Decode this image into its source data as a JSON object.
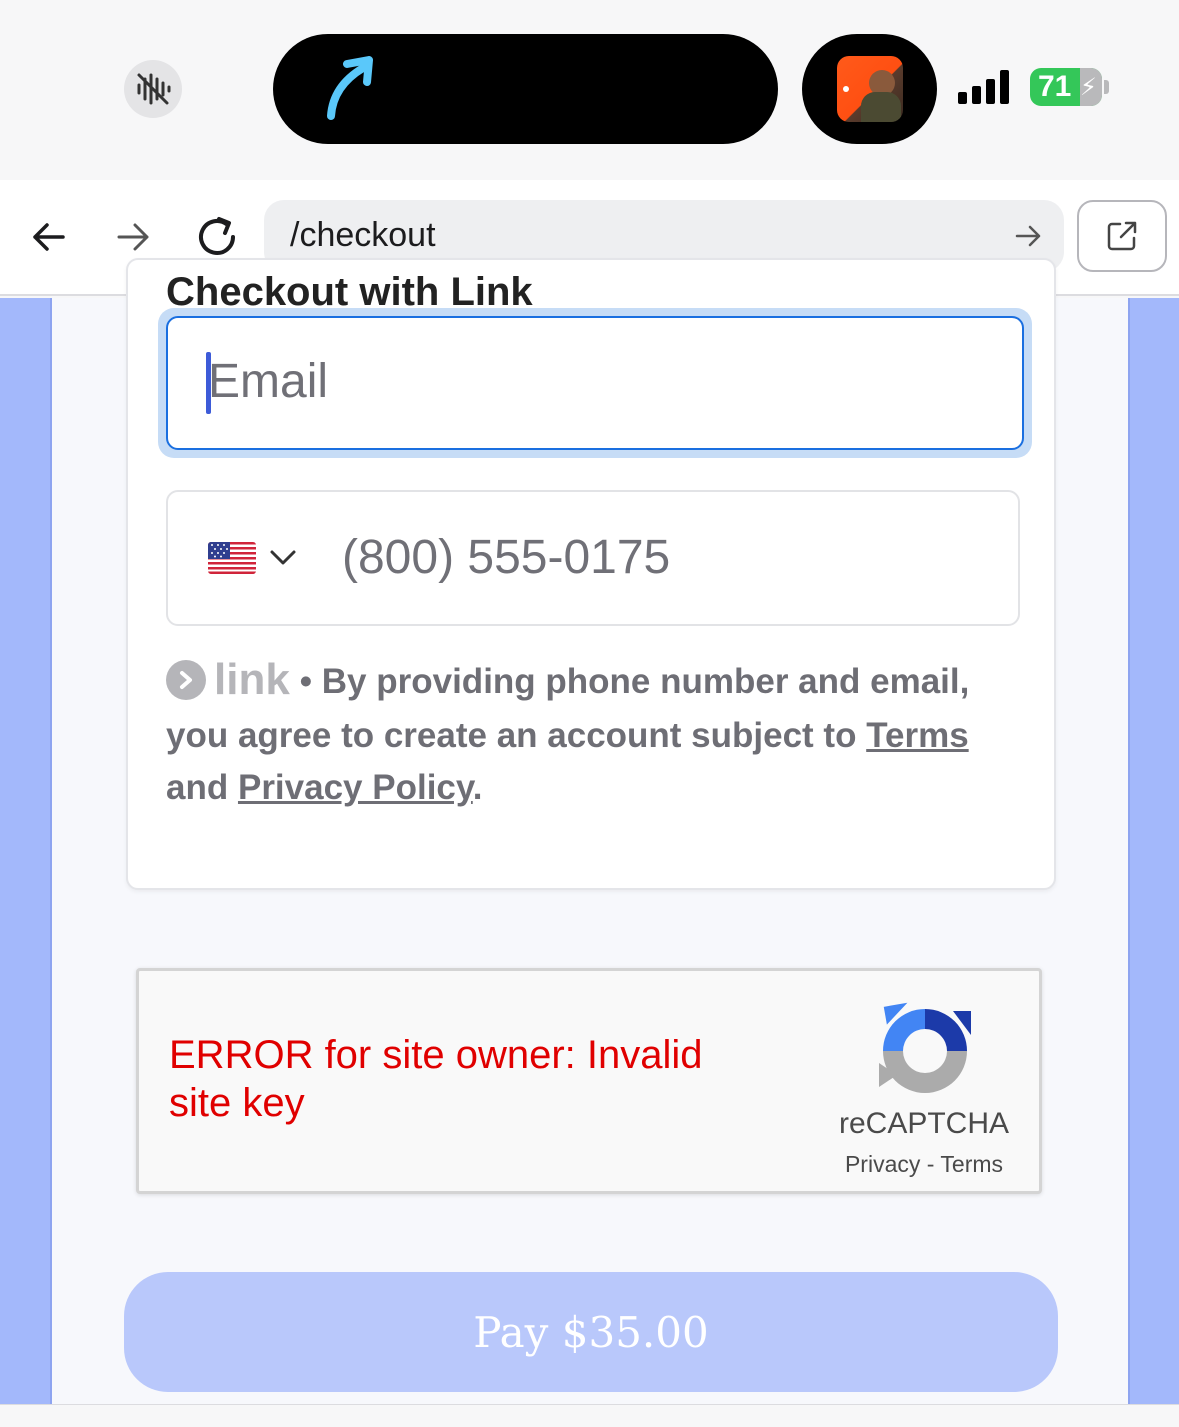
{
  "status_bar": {
    "battery_percent": "71",
    "accent_green": "#34c759"
  },
  "browser": {
    "url": "/checkout"
  },
  "card": {
    "title": "Checkout with Link",
    "email_placeholder": "Email",
    "phone_placeholder": "(800) 555-0175",
    "country_flag": "us-flag",
    "link_brand": "link",
    "legal_text": "• By providing phone number and email, you agree to create an account subject to",
    "terms_link": "Terms",
    "and_text": "and",
    "privacy_link": "Privacy Policy",
    "period": "."
  },
  "recaptcha": {
    "error": "ERROR for site owner: Invalid site key",
    "brand": "reCAPTCHA",
    "privacy": "Privacy",
    "separator": "-",
    "terms": "Terms"
  },
  "pay_button": {
    "label": "Pay $35.00",
    "color": "#b9c8fb"
  }
}
